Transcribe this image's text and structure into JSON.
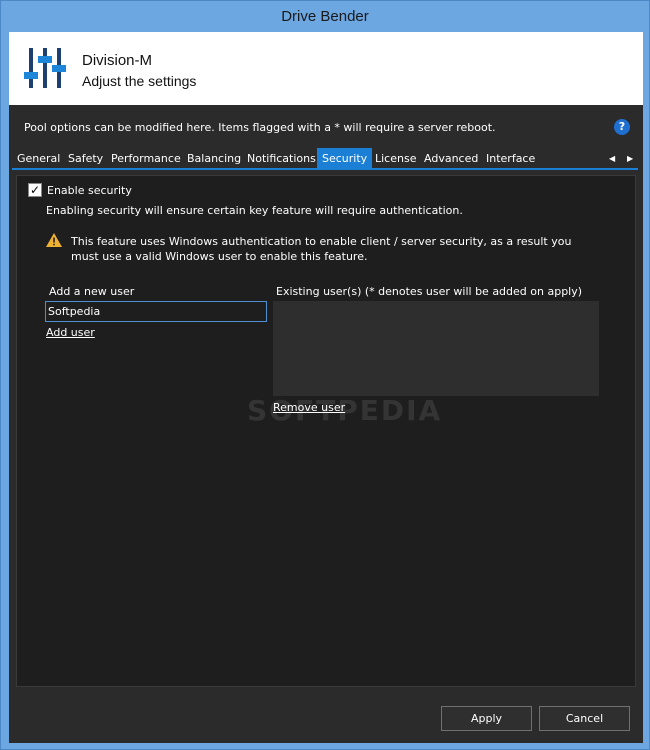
{
  "window": {
    "title": "Drive Bender"
  },
  "header": {
    "company": "Division-M",
    "subtitle": "Adjust the settings"
  },
  "info": {
    "text": "Pool options can be modified here. Items flagged with a * will require a server reboot.",
    "help_glyph": "?"
  },
  "tabs": [
    {
      "label": "General",
      "active": false
    },
    {
      "label": "Safety",
      "active": false
    },
    {
      "label": "Performance",
      "active": false
    },
    {
      "label": "Balancing",
      "active": false
    },
    {
      "label": "Notifications",
      "active": false
    },
    {
      "label": "Security",
      "active": true
    },
    {
      "label": "License",
      "active": false
    },
    {
      "label": "Advanced",
      "active": false
    },
    {
      "label": "Interface",
      "active": false
    }
  ],
  "security": {
    "enable_label": "Enable security",
    "enabled": true,
    "check_glyph": "✓",
    "description": "Enabling security will ensure certain key feature will require authentication.",
    "warning": "This feature uses Windows authentication to enable client / server security, as a result you must use a valid Windows user to enable this feature.",
    "add_user_label": "Add a new user",
    "add_user_value": "Softpedia",
    "add_user_link": "Add user",
    "existing_label": "Existing user(s) (* denotes user will be added on apply)",
    "existing_users": [],
    "remove_link": "Remove user"
  },
  "watermark": "SOFTPEDIA",
  "buttons": {
    "apply": "Apply",
    "cancel": "Cancel"
  },
  "colors": {
    "accent": "#1c7fd6",
    "panel": "#2b2b2b",
    "frame": "#6ca7e2"
  }
}
